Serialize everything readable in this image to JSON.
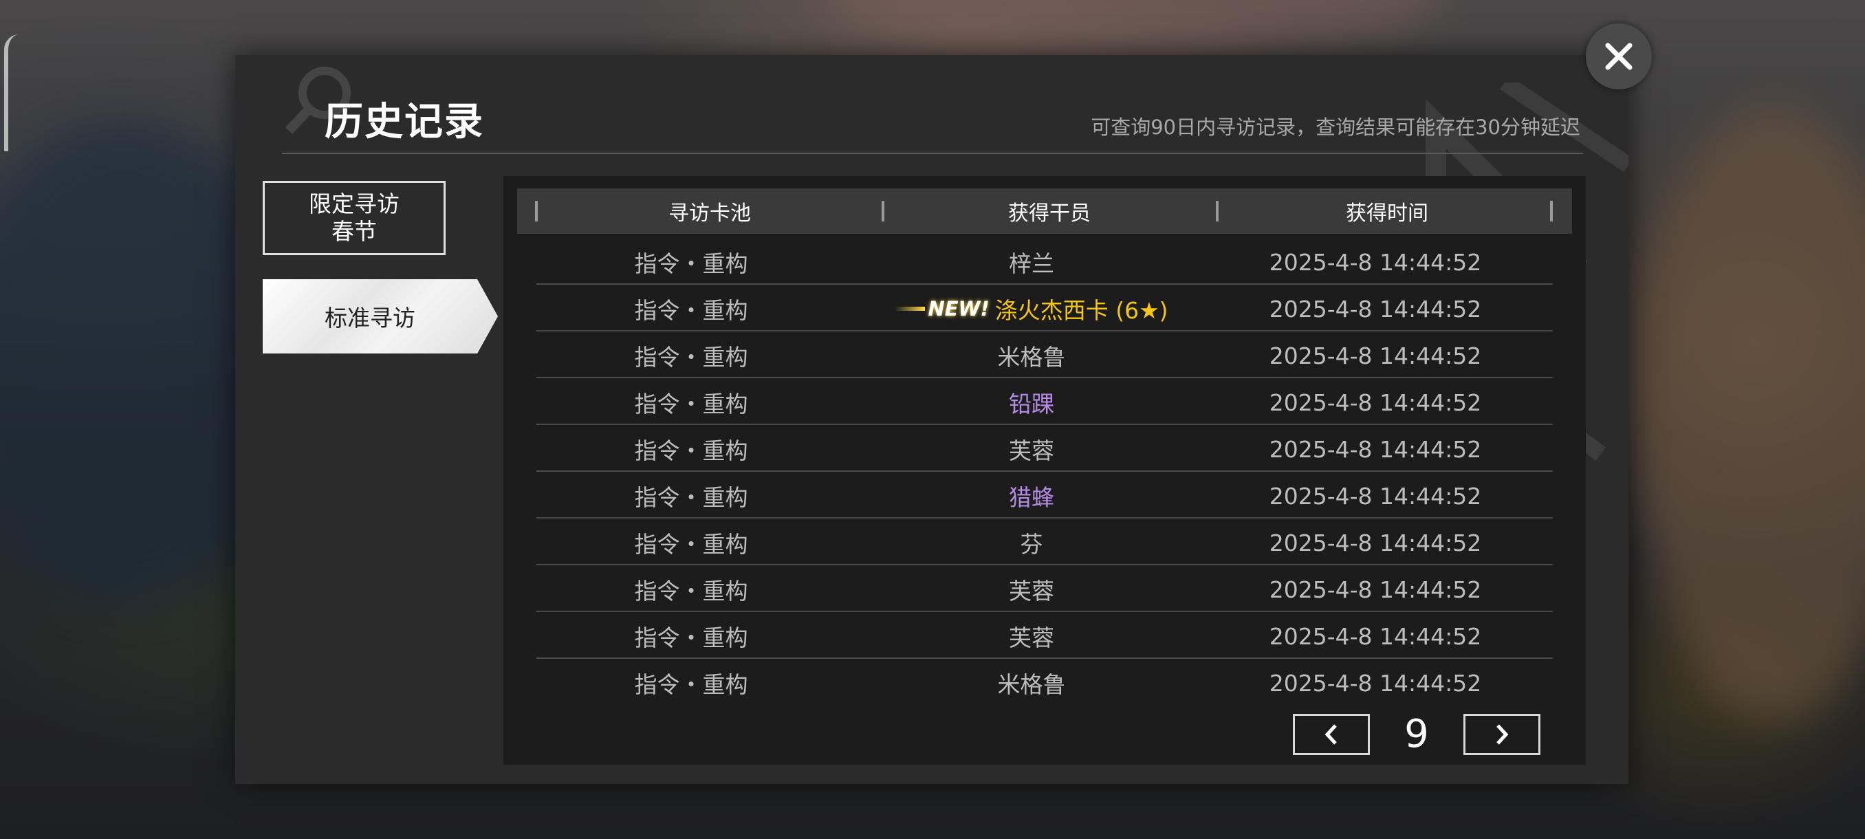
{
  "header": {
    "title": "历史记录",
    "note": "可查询90日内寻访记录，查询结果可能存在30分钟延迟"
  },
  "tabs": [
    {
      "label_line1": "限定寻访",
      "label_line2": "春节"
    },
    {
      "label": "标准寻访"
    }
  ],
  "table": {
    "columns": [
      "寻访卡池",
      "获得干员",
      "获得时间"
    ],
    "rows": [
      {
        "pool": "指令・重构",
        "operator": "梓兰",
        "time": "2025-4-8 14:44:52",
        "color": "#bdbdbd"
      },
      {
        "pool": "指令・重构",
        "operator": "涤火杰西卡 (6★)",
        "time": "2025-4-8 14:44:52",
        "color": "#f5c518",
        "badge": "NEW!"
      },
      {
        "pool": "指令・重构",
        "operator": "米格鲁",
        "time": "2025-4-8 14:44:52",
        "color": "#bdbdbd"
      },
      {
        "pool": "指令・重构",
        "operator": "铅踝",
        "time": "2025-4-8 14:44:52",
        "color": "#b48ce6"
      },
      {
        "pool": "指令・重构",
        "operator": "芙蓉",
        "time": "2025-4-8 14:44:52",
        "color": "#bdbdbd"
      },
      {
        "pool": "指令・重构",
        "operator": "猎蜂",
        "time": "2025-4-8 14:44:52",
        "color": "#b48ce6"
      },
      {
        "pool": "指令・重构",
        "operator": "芬",
        "time": "2025-4-8 14:44:52",
        "color": "#bdbdbd"
      },
      {
        "pool": "指令・重构",
        "operator": "芙蓉",
        "time": "2025-4-8 14:44:52",
        "color": "#bdbdbd"
      },
      {
        "pool": "指令・重构",
        "operator": "芙蓉",
        "time": "2025-4-8 14:44:52",
        "color": "#bdbdbd"
      },
      {
        "pool": "指令・重构",
        "operator": "米格鲁",
        "time": "2025-4-8 14:44:52",
        "color": "#bdbdbd"
      }
    ]
  },
  "pager": {
    "page": "9",
    "prev_icon": "chevron-left-icon",
    "next_icon": "chevron-right-icon"
  },
  "close_icon": "close-icon",
  "colors": {
    "six_star": "#f5c518",
    "four_star": "#b48ce6",
    "default_text": "#bdbdbd"
  }
}
